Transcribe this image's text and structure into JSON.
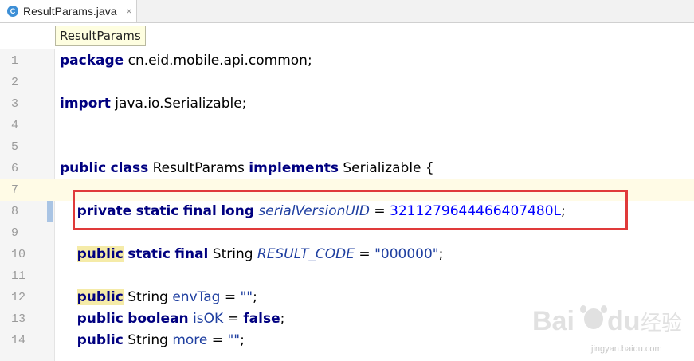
{
  "tab": {
    "file_icon": "C",
    "title": "ResultParams.java",
    "close": "×"
  },
  "breadcrumb": {
    "label": "ResultParams"
  },
  "lines": [
    {
      "n": "1",
      "tokens": [
        {
          "t": "package",
          "c": "kw"
        },
        {
          "t": " cn.eid.mobile.api.common;",
          "c": "plain"
        }
      ]
    },
    {
      "n": "2",
      "tokens": []
    },
    {
      "n": "3",
      "tokens": [
        {
          "t": "import",
          "c": "kw"
        },
        {
          "t": " java.io.Serializable;",
          "c": "plain"
        }
      ]
    },
    {
      "n": "4",
      "tokens": []
    },
    {
      "n": "5",
      "tokens": []
    },
    {
      "n": "6",
      "tokens": [
        {
          "t": "public",
          "c": "kw"
        },
        {
          "t": " ",
          "c": "plain"
        },
        {
          "t": "class",
          "c": "kw"
        },
        {
          "t": " ResultParams ",
          "c": "plain"
        },
        {
          "t": "implements",
          "c": "kw"
        },
        {
          "t": " Serializable {",
          "c": "plain"
        }
      ]
    },
    {
      "n": "7",
      "tokens": [],
      "current": true
    },
    {
      "n": "8",
      "tokens": [
        {
          "t": "    ",
          "c": "plain"
        },
        {
          "t": "private",
          "c": "kw"
        },
        {
          "t": " ",
          "c": "plain"
        },
        {
          "t": "static",
          "c": "kw"
        },
        {
          "t": " ",
          "c": "plain"
        },
        {
          "t": "final",
          "c": "kw"
        },
        {
          "t": " ",
          "c": "plain"
        },
        {
          "t": "long",
          "c": "kw"
        },
        {
          "t": " ",
          "c": "plain"
        },
        {
          "t": "serialVersionUID",
          "c": "field"
        },
        {
          "t": " = ",
          "c": "plain"
        },
        {
          "t": "3211279644466407480L",
          "c": "num"
        },
        {
          "t": ";",
          "c": "plain"
        }
      ],
      "marker": true
    },
    {
      "n": "9",
      "tokens": []
    },
    {
      "n": "10",
      "tokens": [
        {
          "t": "    ",
          "c": "plain"
        },
        {
          "t": "public",
          "c": "kw-hl"
        },
        {
          "t": " ",
          "c": "plain"
        },
        {
          "t": "static",
          "c": "kw"
        },
        {
          "t": " ",
          "c": "plain"
        },
        {
          "t": "final",
          "c": "kw"
        },
        {
          "t": " String ",
          "c": "plain"
        },
        {
          "t": "RESULT_CODE",
          "c": "field"
        },
        {
          "t": " = ",
          "c": "plain"
        },
        {
          "t": "\"000000\"",
          "c": "str-blue"
        },
        {
          "t": ";",
          "c": "plain"
        }
      ]
    },
    {
      "n": "11",
      "tokens": []
    },
    {
      "n": "12",
      "tokens": [
        {
          "t": "    ",
          "c": "plain"
        },
        {
          "t": "public",
          "c": "kw-hl"
        },
        {
          "t": " String ",
          "c": "plain"
        },
        {
          "t": "envTag",
          "c": "ifield"
        },
        {
          "t": " = ",
          "c": "plain"
        },
        {
          "t": "\"\"",
          "c": "str-blue"
        },
        {
          "t": ";",
          "c": "plain"
        }
      ]
    },
    {
      "n": "13",
      "tokens": [
        {
          "t": "    ",
          "c": "plain"
        },
        {
          "t": "public",
          "c": "kw"
        },
        {
          "t": " ",
          "c": "plain"
        },
        {
          "t": "boolean",
          "c": "kw"
        },
        {
          "t": " ",
          "c": "plain"
        },
        {
          "t": "isOK",
          "c": "ifield"
        },
        {
          "t": " = ",
          "c": "plain"
        },
        {
          "t": "false",
          "c": "kw"
        },
        {
          "t": ";",
          "c": "plain"
        }
      ]
    },
    {
      "n": "14",
      "tokens": [
        {
          "t": "    ",
          "c": "plain"
        },
        {
          "t": "public",
          "c": "kw"
        },
        {
          "t": " String ",
          "c": "plain"
        },
        {
          "t": "more",
          "c": "ifield"
        },
        {
          "t": " = ",
          "c": "plain"
        },
        {
          "t": "\"\"",
          "c": "str-blue"
        },
        {
          "t": ";",
          "c": "plain"
        }
      ]
    }
  ],
  "watermark": {
    "brand": "Bai",
    "brand2": "du",
    "cn": "经验",
    "url": "jingyan.baidu.com"
  }
}
